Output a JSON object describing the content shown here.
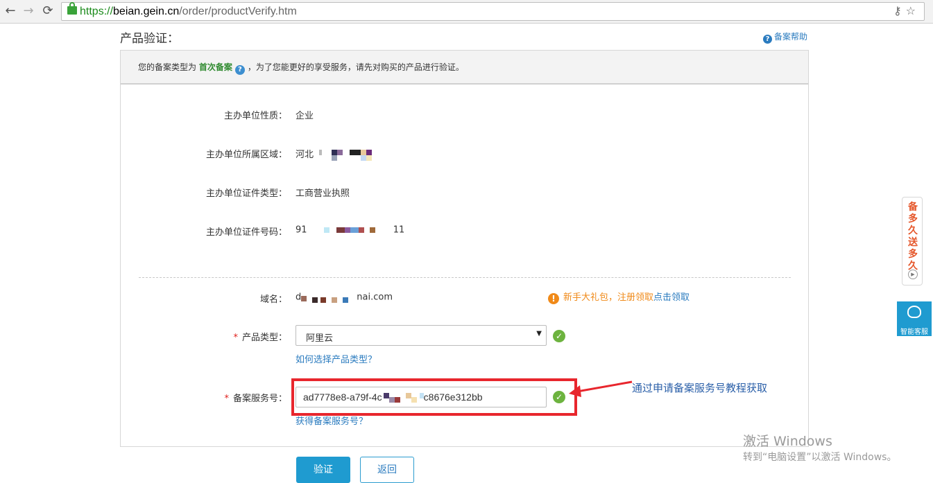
{
  "browser": {
    "back_icon": "←",
    "forward_icon": "→",
    "reload_icon": "⟳",
    "url_protocol": "https://",
    "url_host": "beian.gein.cn",
    "url_path": "/order/productVerify.htm",
    "key_icon": "⚷",
    "star_icon": "☆"
  },
  "page": {
    "title": "产品验证：",
    "help_link": "备案帮助"
  },
  "notice": {
    "prefix": "您的备案类型为",
    "filing_type": "首次备案",
    "suffix": "，为了您能更好的享受服务，请先对购买的产品进行验证。"
  },
  "fields": {
    "org_nature_label": "主办单位性质：",
    "org_nature_value": "企业",
    "org_region_label": "主办单位所属区域：",
    "org_region_value": "河北",
    "cert_type_label": "主办单位证件类型：",
    "cert_type_value": "工商营业执照",
    "cert_no_label": "主办单位证件号码：",
    "cert_no_prefix": "91",
    "cert_no_suffix": "11",
    "domain_label": "域名：",
    "domain_prefix": "d",
    "domain_suffix": "nai.com",
    "product_type_label": "产品类型：",
    "product_type_value": "阿里云",
    "product_type_help": "如何选择产品类型？",
    "serial_label": "备案服务号：",
    "serial_prefix": "ad7778e8-a79f-4c",
    "serial_suffix": "c8676e312bb",
    "serial_help": "获得备案服务号？",
    "required_mark": "*"
  },
  "gift": {
    "text": "新手大礼包，注册领取",
    "link": "点击领取"
  },
  "annotation": {
    "text": "通过申请备案服务号教程获取"
  },
  "buttons": {
    "verify": "验证",
    "back": "返回"
  },
  "side": {
    "promo_text": "备多久送多久",
    "service_label": "智能客服"
  },
  "watermark": {
    "line1": "激活 Windows",
    "line2": "转到“电脑设置”以激活 Windows。"
  },
  "colors": {
    "accent_blue": "#1f9bd0",
    "link_blue": "#2a7bbf",
    "ok_green": "#6db33f",
    "highlight_red": "#e8262d",
    "gift_orange": "#f08a19"
  }
}
